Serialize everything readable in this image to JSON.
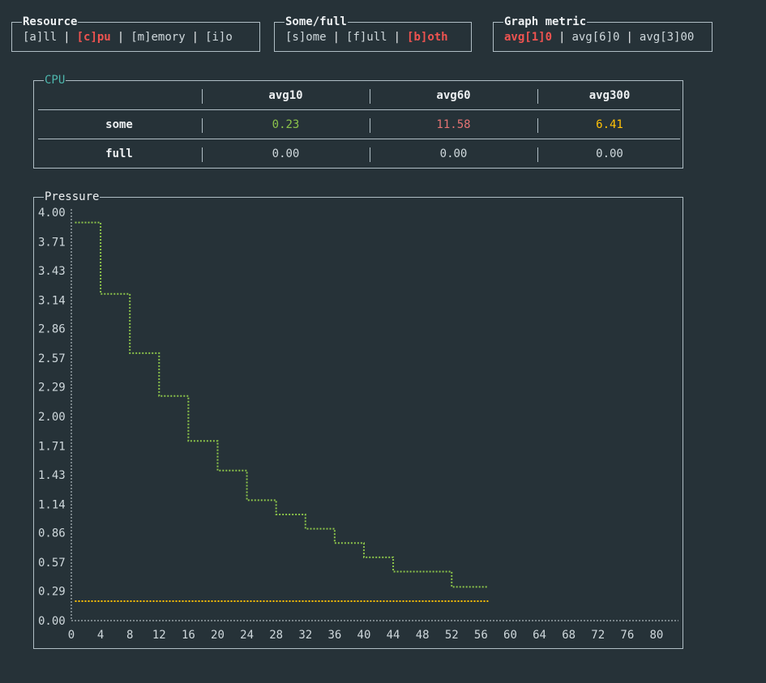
{
  "resource": {
    "title": "Resource",
    "options": [
      {
        "label": "[a]ll",
        "selected": false
      },
      {
        "label": "[c]pu",
        "selected": true
      },
      {
        "label": "[m]emory",
        "selected": false
      },
      {
        "label": "[i]o",
        "selected": false
      }
    ]
  },
  "some_full": {
    "title": "Some/full",
    "options": [
      {
        "label": "[s]ome",
        "selected": false
      },
      {
        "label": "[f]ull",
        "selected": false
      },
      {
        "label": "[b]oth",
        "selected": true
      }
    ]
  },
  "graph_metric": {
    "title": "Graph metric",
    "options": [
      {
        "label": "avg[1]0",
        "selected": true
      },
      {
        "label": "avg[6]0",
        "selected": false
      },
      {
        "label": "avg[3]00",
        "selected": false
      }
    ]
  },
  "cpu": {
    "title": "CPU",
    "columns": [
      "",
      "avg10",
      "avg60",
      "avg300"
    ],
    "rows": [
      {
        "label": "some",
        "values": [
          "0.23",
          "11.58",
          "6.41"
        ]
      },
      {
        "label": "full",
        "values": [
          "0.00",
          "0.00",
          "0.00"
        ]
      }
    ]
  },
  "colors": {
    "green": "#8bc34a",
    "red": "#e57373",
    "yellow": "#ffc107",
    "selected": "#ef5350"
  },
  "chart_data": {
    "type": "line",
    "title": "Pressure",
    "xlim": [
      0,
      83
    ],
    "ylim": [
      0,
      4.0
    ],
    "x_ticks": [
      0,
      4,
      8,
      12,
      16,
      20,
      24,
      28,
      32,
      36,
      40,
      44,
      48,
      52,
      56,
      60,
      64,
      68,
      72,
      76,
      80
    ],
    "y_ticks": [
      "0.00",
      "0.29",
      "0.57",
      "0.86",
      "1.14",
      "1.43",
      "1.71",
      "2.00",
      "2.29",
      "2.57",
      "2.86",
      "3.14",
      "3.43",
      "3.71",
      "4.00"
    ],
    "series": [
      {
        "color": "#8bc34a",
        "style": "step",
        "x": [
          0.5,
          4,
          8,
          12,
          16,
          20,
          24,
          28,
          32,
          36,
          40,
          44,
          48,
          52,
          57
        ],
        "y": [
          3.9,
          3.2,
          2.62,
          2.2,
          1.76,
          1.47,
          1.18,
          1.04,
          0.9,
          0.76,
          0.62,
          0.48,
          0.48,
          0.33,
          0.33
        ]
      },
      {
        "color": "#ffc107",
        "style": "step",
        "x": [
          0.5,
          57
        ],
        "y": [
          0.19,
          0.19
        ]
      }
    ]
  }
}
